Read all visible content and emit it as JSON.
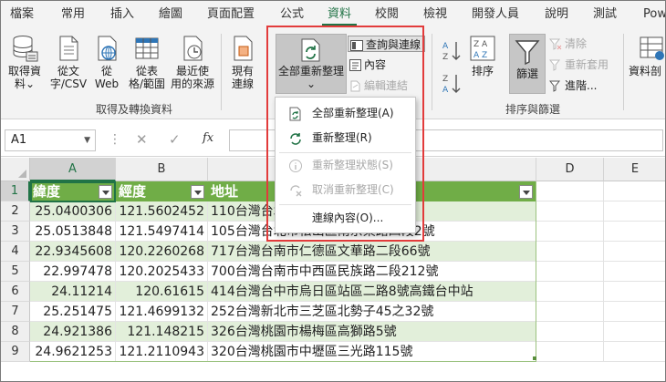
{
  "ribbon_tabs": [
    "檔案",
    "常用",
    "插入",
    "繪圖",
    "頁面配置",
    "公式",
    "資料",
    "校閱",
    "檢視",
    "開發人員",
    "說明",
    "測試",
    "Pow"
  ],
  "active_tab": "資料",
  "ribbon": {
    "get_data": [
      "取得資",
      "料"
    ],
    "from_text_csv": [
      "從文",
      "字/CSV"
    ],
    "from_web": [
      "從",
      "Web"
    ],
    "from_table_range": [
      "從表",
      "格/範圍"
    ],
    "recent_sources": [
      "最近使",
      "用的來源"
    ],
    "existing_connections": [
      "現有",
      "連線"
    ],
    "group_get_transform": "取得及轉換資料",
    "refresh_all": "全部重新整理",
    "queries_connections": "查詢與連線",
    "properties": "內容",
    "edit_links": "編輯連結",
    "sort": "排序",
    "filter": "篩選",
    "clear": "清除",
    "reapply": "重新套用",
    "advanced": "進階...",
    "data_types": "資料剖",
    "group_sort_filter": "排序與篩選"
  },
  "formula_bar": {
    "name_box": "A1",
    "fx": "fx",
    "formula": ""
  },
  "columns": [
    "A",
    "B",
    "C",
    "D",
    "E"
  ],
  "selected_column": "A",
  "rows": [
    "1",
    "2",
    "3",
    "4",
    "5",
    "6",
    "7",
    "8",
    "9"
  ],
  "table": {
    "headers": [
      "緯度",
      "經度",
      "地址"
    ],
    "data": [
      [
        "25.0400306",
        "121.5602452",
        "110台灣台北市信義區市府路45號"
      ],
      [
        "25.0513848",
        "121.5497414",
        "105台灣台北市松山區南京東路四段2號"
      ],
      [
        "22.9345608",
        "120.2260268",
        "717台灣台南市仁德區文華路二段66號"
      ],
      [
        "22.997478",
        "120.2025433",
        "700台灣台南市中西區民族路二段212號"
      ],
      [
        "24.11214",
        "120.61615",
        "414台灣台中市烏日區站區二路8號高鐵台中站"
      ],
      [
        "25.251475",
        "121.4699132",
        "252台灣新北市三芝區北勢子45之32號"
      ],
      [
        "24.921386",
        "121.148215",
        "326台灣桃園市楊梅區高獅路5號"
      ],
      [
        "24.9621253",
        "121.2110943",
        "320台灣桃園市中壢區三光路115號"
      ]
    ]
  },
  "refresh_menu": {
    "items": [
      {
        "label": "全部重新整理(A)",
        "enabled": true
      },
      {
        "label": "重新整理(R)",
        "enabled": true
      },
      {
        "label": "重新整理狀態(S)",
        "enabled": false
      },
      {
        "label": "取消重新整理(C)",
        "enabled": false
      },
      {
        "label": "連線內容(O)...",
        "enabled": true
      }
    ]
  },
  "colors": {
    "excel_green": "#217346",
    "table_header_green": "#70ad47",
    "band_green": "#e2efda",
    "highlight_red": "#e23b3b"
  }
}
